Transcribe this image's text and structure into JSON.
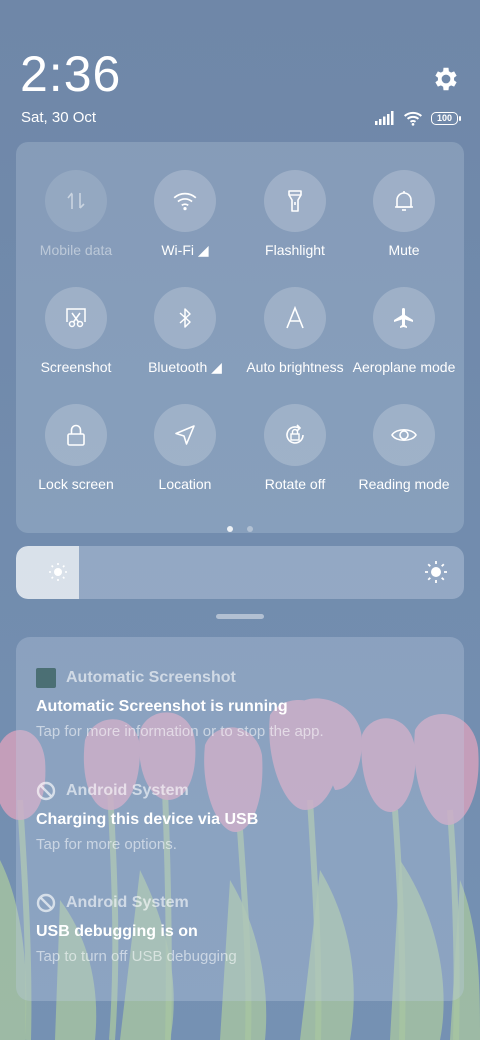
{
  "status": {
    "time": "2:36",
    "date": "Sat, 30 Oct",
    "battery": "100"
  },
  "quick_settings": {
    "tiles": [
      {
        "label": "Mobile data",
        "icon": "mobile-data-icon",
        "enabled": false
      },
      {
        "label": "Wi-Fi ◢",
        "icon": "wifi-icon",
        "enabled": true
      },
      {
        "label": "Flashlight",
        "icon": "flashlight-icon",
        "enabled": true
      },
      {
        "label": "Mute",
        "icon": "bell-icon",
        "enabled": true
      },
      {
        "label": "Screenshot",
        "icon": "screenshot-icon",
        "enabled": true
      },
      {
        "label": "Bluetooth ◢",
        "icon": "bluetooth-icon",
        "enabled": true
      },
      {
        "label": "Auto brightness",
        "icon": "auto-brightness-icon",
        "enabled": true
      },
      {
        "label": "Aeroplane mode",
        "icon": "airplane-icon",
        "enabled": true
      },
      {
        "label": "Lock screen",
        "icon": "lock-icon",
        "enabled": true
      },
      {
        "label": "Location",
        "icon": "location-icon",
        "enabled": true
      },
      {
        "label": "Rotate off",
        "icon": "rotate-lock-icon",
        "enabled": true
      },
      {
        "label": "Reading mode",
        "icon": "eye-icon",
        "enabled": true
      }
    ],
    "page_count": 2,
    "current_page": 1
  },
  "brightness": {
    "level": 0.14
  },
  "notifications": [
    {
      "app": "Automatic Screenshot",
      "title": "Automatic Screenshot is running",
      "text": "Tap for more information or to stop the app.",
      "icon": "app-square-icon"
    },
    {
      "app": "Android System",
      "title": "Charging this device via USB",
      "text": "Tap for more options.",
      "icon": "android-system-icon"
    },
    {
      "app": "Android System",
      "title": "USB debugging is on",
      "text": "Tap to turn off USB debugging",
      "icon": "android-system-icon"
    }
  ],
  "colors": {
    "background": "#7189a9",
    "tulip": "#f0a6bf",
    "stem": "#b9d79a"
  }
}
